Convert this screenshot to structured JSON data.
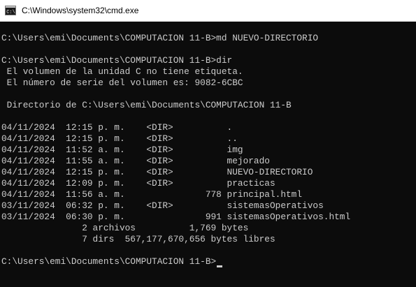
{
  "window": {
    "title": "C:\\Windows\\system32\\cmd.exe",
    "icon": "cmd-icon",
    "colors": {
      "titlebar_bg": "#ffffff",
      "console_bg": "#0c0c0c",
      "console_fg": "#cccccc"
    }
  },
  "console": {
    "lines": [
      "",
      "C:\\Users\\emi\\Documents\\COMPUTACION 11-B>md NUEVO-DIRECTORIO",
      "",
      "C:\\Users\\emi\\Documents\\COMPUTACION 11-B>dir",
      " El volumen de la unidad C no tiene etiqueta.",
      " El número de serie del volumen es: 9082-6CBC",
      "",
      " Directorio de C:\\Users\\emi\\Documents\\COMPUTACION 11-B",
      "",
      "04/11/2024  12:15 p. m.    <DIR>          .",
      "04/11/2024  12:15 p. m.    <DIR>          ..",
      "04/11/2024  11:52 a. m.    <DIR>          img",
      "04/11/2024  11:55 a. m.    <DIR>          mejorado",
      "04/11/2024  12:15 p. m.    <DIR>          NUEVO-DIRECTORIO",
      "04/11/2024  12:09 p. m.    <DIR>          practicas",
      "04/11/2024  11:56 a. m.               778 principal.html",
      "03/11/2024  06:32 p. m.    <DIR>          sistemasOperativos",
      "03/11/2024  06:30 p. m.               991 sistemasOperativos.html",
      "               2 archivos          1,769 bytes",
      "               7 dirs  567,177,670,656 bytes libres",
      "",
      "C:\\Users\\emi\\Documents\\COMPUTACION 11-B>"
    ]
  }
}
